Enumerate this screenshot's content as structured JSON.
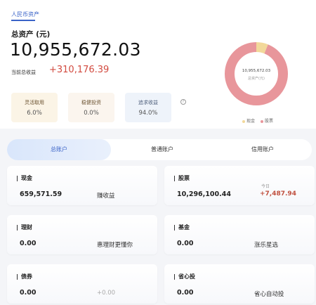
{
  "header": {
    "tab_label": "人民币资产"
  },
  "summary": {
    "total_label": "总资产 (元)",
    "total_value": "10,955,672.03",
    "profit_label": "当前总收益",
    "profit_value": "+310,176.39"
  },
  "allocation": [
    {
      "label": "灵活取用",
      "value": "6.0%"
    },
    {
      "label": "稳健投资",
      "value": "0.0%"
    },
    {
      "label": "追求收益",
      "value": "94.0%"
    }
  ],
  "chart_data": {
    "type": "pie",
    "center_value": "10,955,672.03",
    "center_label": "总资产(元)",
    "slices": [
      {
        "name": "现金",
        "value": 659571.59,
        "color": "#f2d89a"
      },
      {
        "name": "股票",
        "value": 10296100.44,
        "color": "#e8969b"
      }
    ]
  },
  "account_tabs": [
    "总账户",
    "普通账户",
    "信用账户"
  ],
  "cards": {
    "cash": {
      "name": "现金",
      "amount": "659,571.59",
      "extra": "赚收益"
    },
    "stock": {
      "name": "股票",
      "amount": "10,296,100.44",
      "today_label": "今日",
      "today_value": "+7,487.94"
    },
    "wealth": {
      "name": "理财",
      "amount": "0.00",
      "extra": "惠理财更懂你"
    },
    "fund": {
      "name": "基金",
      "amount": "0.00",
      "extra": "涨乐星选"
    },
    "bond": {
      "name": "债券",
      "amount": "0.00",
      "extra": "+0.00"
    },
    "auto": {
      "name": "省心投",
      "amount": "0.00",
      "extra": "省心自动投"
    }
  }
}
